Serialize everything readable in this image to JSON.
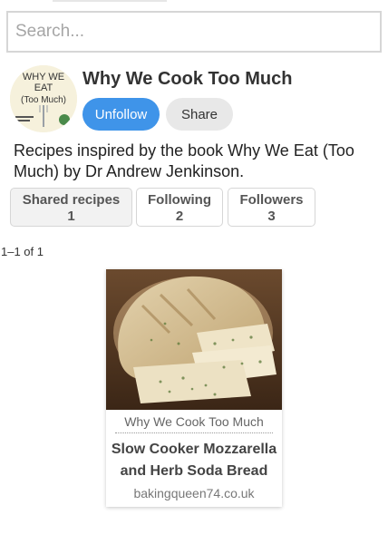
{
  "search": {
    "placeholder": "Search..."
  },
  "profile": {
    "name": "Why We Cook Too Much",
    "avatar_text": [
      "WHY WE",
      "EAT",
      "(Too Much)"
    ],
    "unfollow_label": "Unfollow",
    "share_label": "Share",
    "bio": "Recipes inspired by the book Why We Eat (Too Much) by Dr Andrew Jenkinson."
  },
  "stats": {
    "shared": {
      "label": "Shared recipes",
      "count": "1"
    },
    "following": {
      "label": "Following",
      "count": "2"
    },
    "followers": {
      "label": "Followers",
      "count": "3"
    }
  },
  "results": {
    "count_text": "1–1 of 1"
  },
  "recipes": [
    {
      "source": "Why We Cook Too Much",
      "title": "Slow Cooker Mozzarella and Herb Soda Bread",
      "domain": "bakingqueen74.co.uk"
    }
  ],
  "colors": {
    "accent": "#3f94e9",
    "button_gray": "#e8e8e8",
    "border": "#d6d6d6"
  }
}
